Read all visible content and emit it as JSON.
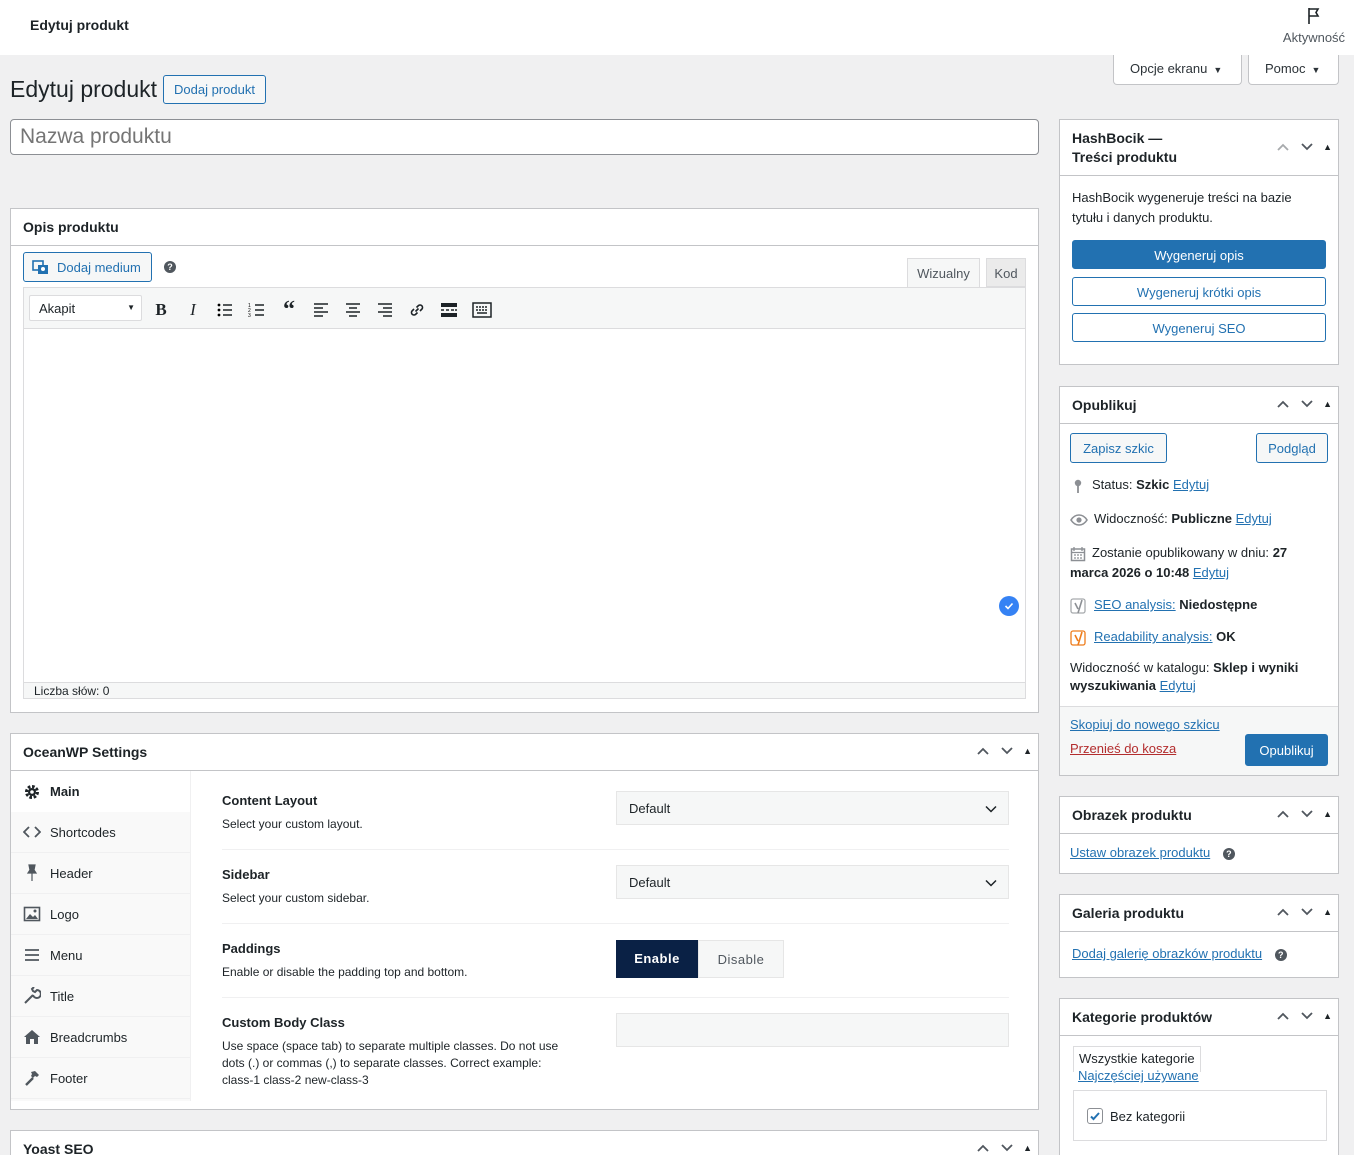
{
  "topbar": {
    "title": "Edytuj produkt",
    "activity_label": "Aktywność"
  },
  "screen_options": {
    "label": "Opcje ekranu",
    "help_label": "Pomoc"
  },
  "page": {
    "heading": "Edytuj produkt",
    "add_new_label": "Dodaj produkt",
    "title_placeholder": "Nazwa produktu"
  },
  "description_box": {
    "title": "Opis produktu",
    "add_media_label": "Dodaj medium",
    "tab_visual": "Wizualny",
    "tab_code": "Kod",
    "format_select": "Akapit",
    "word_count": "Liczba słów: 0"
  },
  "oceanwp": {
    "title": "OceanWP Settings",
    "nav": [
      {
        "label": "Main",
        "icon": "gear-icon"
      },
      {
        "label": "Shortcodes",
        "icon": "code-icon"
      },
      {
        "label": "Header",
        "icon": "pin-icon"
      },
      {
        "label": "Logo",
        "icon": "image-icon"
      },
      {
        "label": "Menu",
        "icon": "menu-icon"
      },
      {
        "label": "Title",
        "icon": "wrench-icon"
      },
      {
        "label": "Breadcrumbs",
        "icon": "home-icon"
      },
      {
        "label": "Footer",
        "icon": "hammer-icon"
      }
    ],
    "fields": {
      "layout_title": "Content Layout",
      "layout_desc": "Select your custom layout.",
      "layout_value": "Default",
      "sidebar_title": "Sidebar",
      "sidebar_desc": "Select your custom sidebar.",
      "sidebar_value": "Default",
      "paddings_title": "Paddings",
      "paddings_desc": "Enable or disable the padding top and bottom.",
      "paddings_enable": "Enable",
      "paddings_disable": "Disable",
      "bodyclass_title": "Custom Body Class",
      "bodyclass_desc": "Use space (space tab) to separate multiple classes. Do not use dots (.) or commas (,) to separate classes. Correct example: class-1 class-2 new-class-3"
    }
  },
  "yoast": {
    "title": "Yoast SEO"
  },
  "hashbocik": {
    "title_line1": "HashBocik —",
    "title_line2": "Treści produktu",
    "desc": "HashBocik wygeneruje treści na bazie tytułu i danych produktu.",
    "btn_desc": "Wygeneruj opis",
    "btn_short": "Wygeneruj krótki opis",
    "btn_seo": "Wygeneruj SEO"
  },
  "publish": {
    "title": "Opublikuj",
    "save_draft": "Zapisz szkic",
    "preview": "Podgląd",
    "status_label": "Status:",
    "status_value": "Szkic",
    "edit": "Edytuj",
    "visibility_label": "Widoczność:",
    "visibility_value": "Publiczne",
    "schedule_label": "Zostanie opublikowany w dniu:",
    "schedule_value_1": "27",
    "schedule_value_2": "marca 2026 o 10:48",
    "seo_label": "SEO analysis:",
    "seo_value": "Niedostępne",
    "readability_label": "Readability analysis:",
    "readability_value": "OK",
    "catalog_label": "Widoczność w katalogu:",
    "catalog_value_1": "Sklep i wyniki",
    "catalog_value_2": "wyszukiwania",
    "copy_draft": "Skopiuj do nowego szkicu",
    "trash": "Przenieś do kosza",
    "publish_btn": "Opublikuj"
  },
  "product_image": {
    "title": "Obrazek produktu",
    "link": "Ustaw obrazek produktu"
  },
  "gallery": {
    "title": "Galeria produktu",
    "link": "Dodaj galerię obrazków produktu"
  },
  "categories": {
    "title": "Kategorie produktów",
    "tab_all": "Wszystkie kategorie",
    "tab_popular": "Najczęściej używane",
    "item": "Bez kategorii"
  },
  "colors": {
    "accent": "#2271b1",
    "enable_bg": "#0a2145",
    "danger": "#b32d2e"
  }
}
